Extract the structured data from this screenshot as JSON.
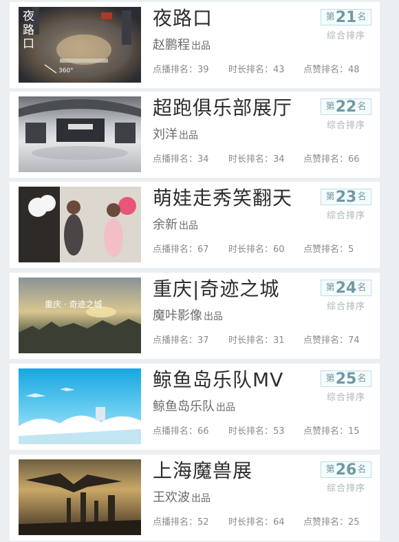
{
  "labels": {
    "rank_prefix": "第",
    "rank_suffix": "名",
    "rank_caption": "综合排序",
    "producer": "出品",
    "play_rank": "点播排名：",
    "duration_rank": "时长排名：",
    "like_rank": "点赞排名："
  },
  "items": [
    {
      "title": "夜路口",
      "author": "赵鹏程",
      "rank": "21",
      "play": "39",
      "duration": "43",
      "like": "48",
      "thumb_label": "夜路口",
      "thumb_badge": "360°",
      "thumb_banner": ""
    },
    {
      "title": "超跑俱乐部展厅",
      "author": "刘洋",
      "rank": "22",
      "play": "34",
      "duration": "34",
      "like": "66",
      "thumb_label": "",
      "thumb_badge": "",
      "thumb_banner": ""
    },
    {
      "title": "萌娃走秀笑翻天",
      "author": "余新",
      "rank": "23",
      "play": "67",
      "duration": "60",
      "like": "5",
      "thumb_label": "",
      "thumb_badge": "",
      "thumb_banner": ""
    },
    {
      "title": "重庆|奇迹之城",
      "author": "魔咔影像",
      "rank": "24",
      "play": "37",
      "duration": "31",
      "like": "74",
      "thumb_label": "",
      "thumb_badge": "",
      "thumb_banner": "重庆 · 奇迹之城"
    },
    {
      "title": "鲸鱼岛乐队MV",
      "author": "鲸鱼岛乐队",
      "rank": "25",
      "play": "66",
      "duration": "53",
      "like": "15",
      "thumb_label": "",
      "thumb_badge": "",
      "thumb_banner": ""
    },
    {
      "title": "上海魔兽展",
      "author": "王欢波",
      "rank": "26",
      "play": "52",
      "duration": "64",
      "like": "25",
      "thumb_label": "",
      "thumb_badge": "",
      "thumb_banner": ""
    }
  ],
  "colors": {
    "page_bg": "#eceff2",
    "card_bg": "#ffffff",
    "title": "#2c2c2c",
    "rank_accent": "#6f99a3",
    "rank_border": "#b9dfe7"
  }
}
